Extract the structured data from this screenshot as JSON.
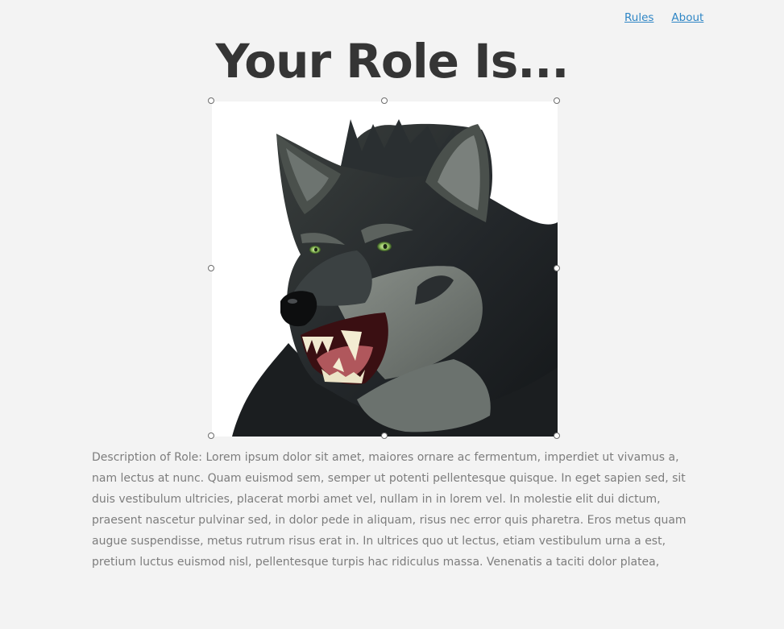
{
  "nav": {
    "links": [
      {
        "label": "Rules"
      },
      {
        "label": "About"
      }
    ]
  },
  "page": {
    "title": "Your Role Is..."
  },
  "role_image": {
    "icon": "wolf-illustration"
  },
  "description": {
    "text": "Description of Role: Lorem ipsum dolor sit amet, maiores ornare ac fermentum, imperdiet ut vivamus a, nam lectus at nunc. Quam euismod sem, semper ut potenti pellentesque quisque. In eget sapien sed, sit duis vestibulum ultricies, placerat morbi amet vel, nullam in in lorem vel. In molestie elit dui dictum, praesent nascetur pulvinar sed, in dolor pede in aliquam, risus nec error quis pharetra. Eros metus quam augue suspendisse, metus rutrum risus erat in.  In ultrices quo ut lectus, etiam vestibulum urna a est, pretium luctus euismod nisl, pellentesque turpis hac ridiculus massa. Venenatis a taciti dolor platea,"
  }
}
